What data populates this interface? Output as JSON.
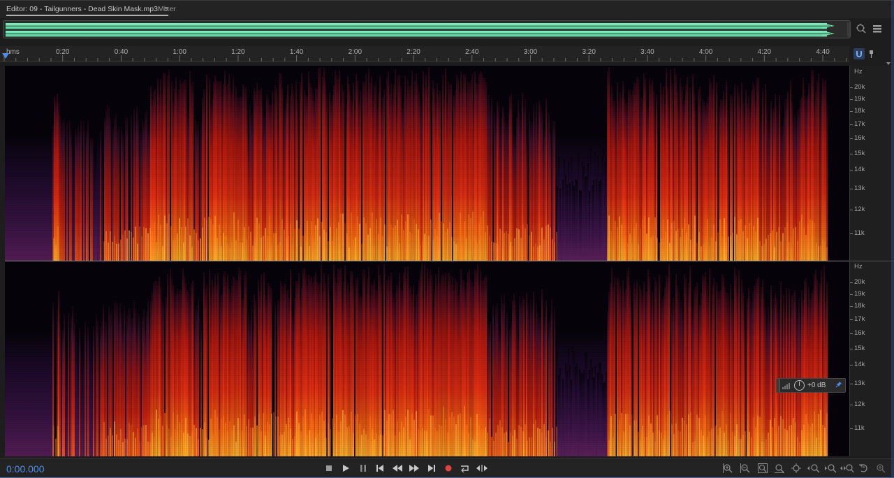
{
  "tabs": {
    "editor_label": "Editor: 09 - Tailgunners - Dead Skin Mask.mp3",
    "mixer_label": "Mixer"
  },
  "ruler": {
    "unit": "hms",
    "ticks": [
      "0:20",
      "0:40",
      "1:00",
      "1:20",
      "1:40",
      "2:00",
      "2:20",
      "2:40",
      "3:00",
      "3:20",
      "3:40",
      "4:00",
      "4:20",
      "4:40"
    ]
  },
  "hz_scale": {
    "unit": "Hz",
    "labels": [
      "20k",
      "19k",
      "18k",
      "17k",
      "16k",
      "15k",
      "14k",
      "13k",
      "12k",
      "11k"
    ]
  },
  "hud": {
    "value": "+0 dB"
  },
  "transport": {
    "timecode": "0:00.000",
    "buttons": [
      "stop",
      "play",
      "pause",
      "go-to-start",
      "rewind",
      "fast-forward",
      "go-to-end",
      "record",
      "loop",
      "skip-selection"
    ]
  },
  "colors": {
    "accent": "#4d8fe6",
    "waveform": "#6fe3b0",
    "spectrogram_hot": "#ffd23a",
    "spectrogram_mid": "#e0281a",
    "spectrogram_low": "#5a1b4a",
    "background": "#1d1d1d"
  },
  "icons": [
    "menu-icon",
    "zoom-to-selection-icon",
    "panel-icon",
    "snap-icon",
    "marker-icon",
    "pin-icon",
    "volume-knob-icon",
    "zoom-in-amplitude-icon",
    "zoom-out-amplitude-icon",
    "zoom-in-time-icon",
    "zoom-out-full-icon",
    "zoom-in-frequency-icon",
    "zoom-out-frequency-icon"
  ]
}
